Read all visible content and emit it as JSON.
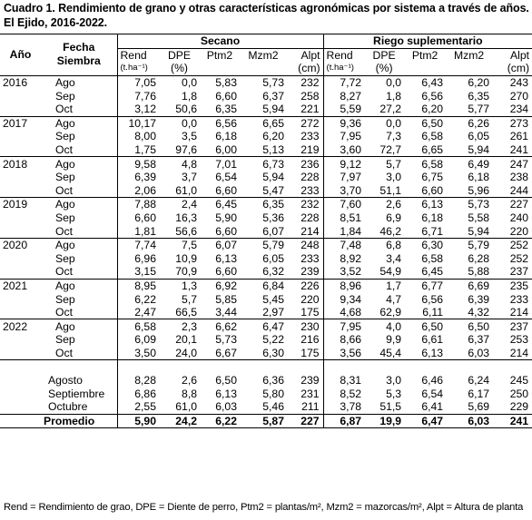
{
  "title": "Cuadro 1. Rendimiento de grano y otras características agronómicas por sistema a través de años. El Ejido, 2016-2022.",
  "header": {
    "anio": "Año",
    "fecha_l1": "Fecha",
    "fecha_l2": "Siembra",
    "secano": "Secano",
    "riego": "Riego suplementario",
    "cols": [
      "Rend",
      "DPE",
      "Ptm2",
      "Mzm2",
      "Alpt"
    ],
    "units": [
      "(t.ha⁻¹)",
      "(%)",
      "",
      "",
      "(cm)"
    ]
  },
  "years": [
    {
      "year": "2016",
      "rows": [
        {
          "fecha": "Ago",
          "s": [
            "7,05",
            "0,0",
            "5,83",
            "5,73",
            "232"
          ],
          "r": [
            "7,72",
            "0,0",
            "6,43",
            "6,20",
            "243"
          ]
        },
        {
          "fecha": "Sep",
          "s": [
            "7,76",
            "1,8",
            "6,60",
            "6,37",
            "258"
          ],
          "r": [
            "8,27",
            "1,8",
            "6,56",
            "6,35",
            "270"
          ]
        },
        {
          "fecha": "Oct",
          "s": [
            "3,12",
            "50,6",
            "6,35",
            "5,94",
            "221"
          ],
          "r": [
            "5,59",
            "27,2",
            "6,20",
            "5,77",
            "234"
          ]
        }
      ]
    },
    {
      "year": "2017",
      "rows": [
        {
          "fecha": "Ago",
          "s": [
            "10,17",
            "0,0",
            "6,56",
            "6,65",
            "272"
          ],
          "r": [
            "9,36",
            "0,0",
            "6,50",
            "6,26",
            "273"
          ]
        },
        {
          "fecha": "Sep",
          "s": [
            "8,00",
            "3,5",
            "6,18",
            "6,20",
            "233"
          ],
          "r": [
            "7,95",
            "7,3",
            "6,58",
            "6,05",
            "261"
          ]
        },
        {
          "fecha": "Oct",
          "s": [
            "1,75",
            "97,6",
            "6,00",
            "5,13",
            "219"
          ],
          "r": [
            "3,60",
            "72,7",
            "6,65",
            "5,94",
            "241"
          ]
        }
      ]
    },
    {
      "year": "2018",
      "rows": [
        {
          "fecha": "Ago",
          "s": [
            "9,58",
            "4,8",
            "7,01",
            "6,73",
            "236"
          ],
          "r": [
            "9,12",
            "5,7",
            "6,58",
            "6,49",
            "247"
          ]
        },
        {
          "fecha": "Sep",
          "s": [
            "6,39",
            "3,7",
            "6,54",
            "5,94",
            "228"
          ],
          "r": [
            "7,97",
            "3,0",
            "6,75",
            "6,18",
            "238"
          ]
        },
        {
          "fecha": "Oct",
          "s": [
            "2,06",
            "61,0",
            "6,60",
            "5,47",
            "233"
          ],
          "r": [
            "3,70",
            "51,1",
            "6,60",
            "5,96",
            "244"
          ]
        }
      ]
    },
    {
      "year": "2019",
      "rows": [
        {
          "fecha": "Ago",
          "s": [
            "7,88",
            "2,4",
            "6,45",
            "6,35",
            "232"
          ],
          "r": [
            "7,60",
            "2,6",
            "6,13",
            "5,73",
            "227"
          ]
        },
        {
          "fecha": "Sep",
          "s": [
            "6,60",
            "16,3",
            "5,90",
            "5,36",
            "228"
          ],
          "r": [
            "8,51",
            "6,9",
            "6,18",
            "5,58",
            "240"
          ]
        },
        {
          "fecha": "Oct",
          "s": [
            "1,81",
            "56,6",
            "6,60",
            "6,07",
            "214"
          ],
          "r": [
            "1,84",
            "46,2",
            "6,71",
            "5,94",
            "220"
          ]
        }
      ]
    },
    {
      "year": "2020",
      "rows": [
        {
          "fecha": "Ago",
          "s": [
            "7,74",
            "7,5",
            "6,07",
            "5,79",
            "248"
          ],
          "r": [
            "7,48",
            "6,8",
            "6,30",
            "5,79",
            "252"
          ]
        },
        {
          "fecha": "Sep",
          "s": [
            "6,96",
            "10,9",
            "6,13",
            "6,05",
            "233"
          ],
          "r": [
            "8,92",
            "3,4",
            "6,58",
            "6,28",
            "252"
          ]
        },
        {
          "fecha": "Oct",
          "s": [
            "3,15",
            "70,9",
            "6,60",
            "6,32",
            "239"
          ],
          "r": [
            "3,52",
            "54,9",
            "6,45",
            "5,88",
            "237"
          ]
        }
      ]
    },
    {
      "year": "2021",
      "rows": [
        {
          "fecha": "Ago",
          "s": [
            "8,95",
            "1,3",
            "6,92",
            "6,84",
            "226"
          ],
          "r": [
            "8,96",
            "1,7",
            "6,77",
            "6,69",
            "235"
          ]
        },
        {
          "fecha": "Sep",
          "s": [
            "6,22",
            "5,7",
            "5,85",
            "5,45",
            "220"
          ],
          "r": [
            "9,34",
            "4,7",
            "6,56",
            "6,39",
            "233"
          ]
        },
        {
          "fecha": "Oct",
          "s": [
            "2,47",
            "66,5",
            "3,44",
            "2,97",
            "175"
          ],
          "r": [
            "4,68",
            "62,9",
            "6,11",
            "4,32",
            "214"
          ]
        }
      ]
    },
    {
      "year": "2022",
      "rows": [
        {
          "fecha": "Ago",
          "s": [
            "6,58",
            "2,3",
            "6,62",
            "6,47",
            "230"
          ],
          "r": [
            "7,95",
            "4,0",
            "6,50",
            "6,50",
            "237"
          ]
        },
        {
          "fecha": "Sep",
          "s": [
            "6,09",
            "20,1",
            "5,73",
            "5,22",
            "216"
          ],
          "r": [
            "8,66",
            "9,9",
            "6,61",
            "6,37",
            "253"
          ]
        },
        {
          "fecha": "Oct",
          "s": [
            "3,50",
            "24,0",
            "6,67",
            "6,30",
            "175"
          ],
          "r": [
            "3,56",
            "45,4",
            "6,13",
            "6,03",
            "214"
          ]
        }
      ]
    }
  ],
  "averages": [
    {
      "label": "Agosto",
      "s": [
        "8,28",
        "2,6",
        "6,50",
        "6,36",
        "239"
      ],
      "r": [
        "8,31",
        "3,0",
        "6,46",
        "6,24",
        "245"
      ]
    },
    {
      "label": "Septiembre",
      "s": [
        "6,86",
        "8,8",
        "6,13",
        "5,80",
        "231"
      ],
      "r": [
        "8,52",
        "5,3",
        "6,54",
        "6,17",
        "250"
      ]
    },
    {
      "label": "Octubre",
      "s": [
        "2,55",
        "61,0",
        "6,03",
        "5,46",
        "211"
      ],
      "r": [
        "3,78",
        "51,5",
        "6,41",
        "5,69",
        "229"
      ]
    }
  ],
  "promedio": {
    "label": "Promedio",
    "s": [
      "5,90",
      "24,2",
      "6,22",
      "5,87",
      "227"
    ],
    "r": [
      "6,87",
      "19,9",
      "6,47",
      "6,03",
      "241"
    ]
  },
  "footnote": "Rend = Rendimiento de grao, DPE = Diente de perro, Ptm2 = plantas/m², Mzm2 = mazorcas/m², Alpt = Altura de planta"
}
